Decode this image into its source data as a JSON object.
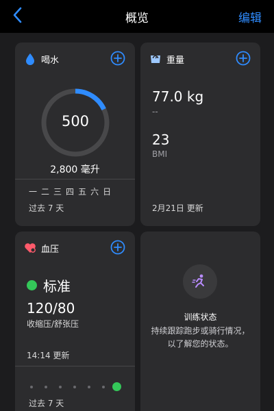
{
  "nav": {
    "title": "概览",
    "edit_label": "编辑",
    "back_icon": "chevron-left-icon"
  },
  "colors": {
    "accent": "#2f8cff",
    "status_green": "#34c759",
    "card_bg": "#2c2c2e",
    "grid_bg": "#1c1c1e",
    "ring_progress": "#2f8cff",
    "heart": "#ff5a6b"
  },
  "water": {
    "title": "喝水",
    "icon": "water-drop-icon",
    "value": "500",
    "goal": "2,800 毫升",
    "progress_fraction": 0.18,
    "weekdays": [
      "一",
      "二",
      "三",
      "四",
      "五",
      "六",
      "日"
    ],
    "footer": "过去 7 天"
  },
  "weight": {
    "title": "重量",
    "icon": "scale-icon",
    "value": "77.0 kg",
    "change": "--",
    "bmi_value": "23",
    "bmi_label": "BMI",
    "updated": "2月21日 更新"
  },
  "blood_pressure": {
    "title": "血压",
    "icon": "heart-icon",
    "status": "标准",
    "reading": "120/80",
    "reading_label": "收缩压/舒张压",
    "updated": "14:14 更新",
    "footer": "过去 7 天"
  },
  "training": {
    "icon": "runner-icon",
    "title": "训练状态",
    "description": "持续跟踪跑步或骑行情况，以了解您的状态。"
  }
}
